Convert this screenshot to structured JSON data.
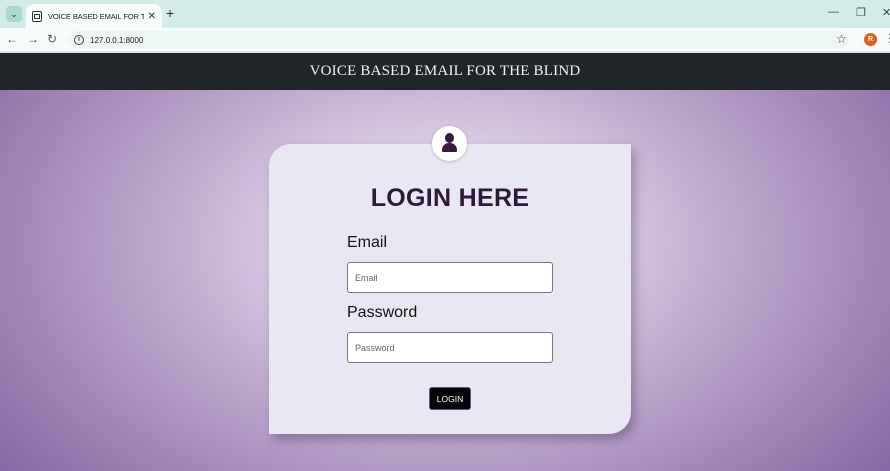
{
  "browser": {
    "tab_title": "VOICE BASED EMAIL FOR THE BLIND",
    "tab_close": "✕",
    "new_tab": "+",
    "url": "127.0.0.1:8000",
    "profile_initial": "R",
    "icons": [
      "tab-search-icon",
      "page-favicon-icon",
      "back-icon",
      "forward-icon",
      "reload-icon",
      "info-icon",
      "star-icon",
      "kebab-menu-icon",
      "minimize-icon",
      "restore-icon",
      "close-window-icon"
    ]
  },
  "header": {
    "title": "VOICE BASED EMAIL FOR THE BLIND",
    "background": "#212528"
  },
  "login": {
    "heading": "LOGIN HERE",
    "email_label": "Email",
    "email_placeholder": "Email",
    "email_value": "",
    "password_label": "Password",
    "password_placeholder": "Password",
    "password_value": "",
    "button_label": "LOGIN"
  },
  "colors": {
    "heading": "#2d1a3a",
    "card": "#e9e7f3",
    "background_center": "#ede6f1",
    "background_edge": "#8a6aa4",
    "button": "#050505"
  }
}
